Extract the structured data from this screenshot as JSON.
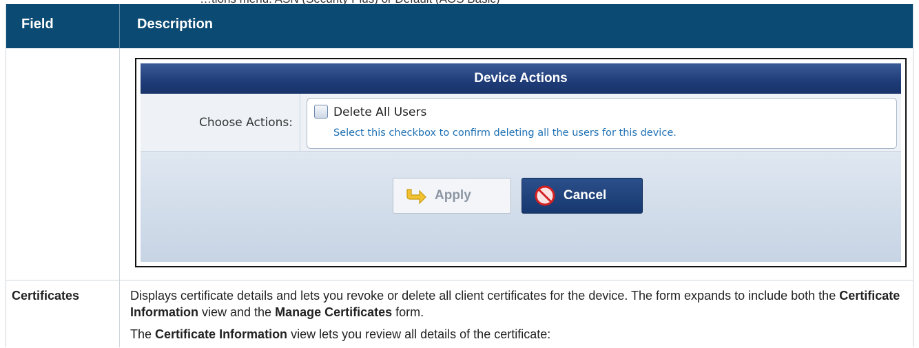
{
  "cut_text": "…tions menu: ASN (Security Plus) or Default (AOS Basic)",
  "table": {
    "col_field": "Field",
    "col_description": "Description"
  },
  "screenshot": {
    "title": "Device Actions",
    "choose_label": "Choose Actions:",
    "option_label": "Delete All Users",
    "option_help": "Select this checkbox to confirm deleting all the users for this device.",
    "checkbox_checked": false,
    "apply_label": "Apply",
    "cancel_label": "Cancel"
  },
  "row2": {
    "field": "Certificates",
    "desc1_a": "Displays certificate details and lets you revoke or delete all client certificates for the device. The form expands to include both the ",
    "desc1_b": "Certificate Information",
    "desc1_c": " view and the ",
    "desc1_d": "Manage Certificates",
    "desc1_e": " form.",
    "desc2_a": "The ",
    "desc2_b": "Certificate Information",
    "desc2_c": " view lets you review all details of the certificate:"
  },
  "colors": {
    "header_bg": "#0b4a73",
    "dialog_title_bg": "#1f3c78",
    "help_text": "#1d6fb3"
  }
}
